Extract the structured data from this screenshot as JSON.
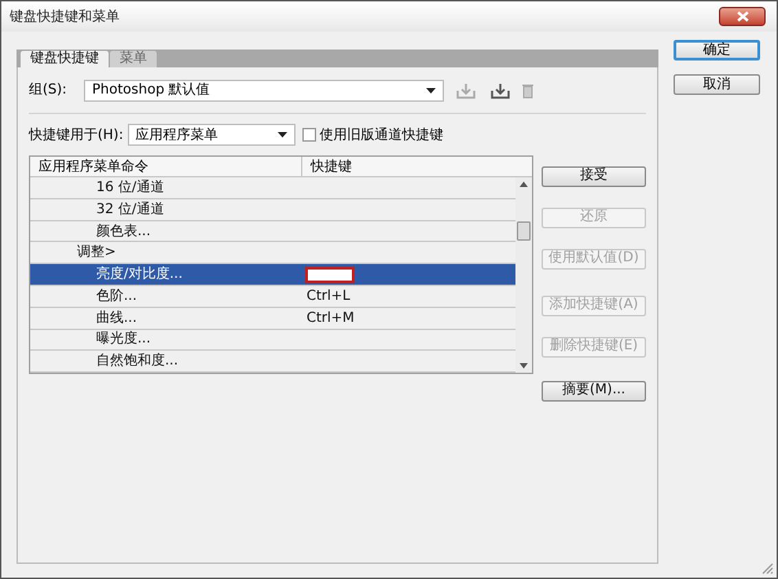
{
  "window": {
    "title": "键盘快捷键和菜单"
  },
  "tabs": [
    {
      "label": "键盘快捷键",
      "selected": true
    },
    {
      "label": "菜单",
      "selected": false
    }
  ],
  "group": {
    "label": "组(S):",
    "value": "Photoshop 默认值"
  },
  "shortcuts_for": {
    "label": "快捷键用于(H):",
    "value": "应用程序菜单"
  },
  "legacy_checkbox": {
    "label": "使用旧版通道快捷键",
    "checked": false
  },
  "table": {
    "columns": [
      "应用程序菜单命令",
      "快捷键"
    ],
    "rows": [
      {
        "kind": "item",
        "label": "16 位/通道",
        "selected": false
      },
      {
        "kind": "item",
        "label": "32 位/通道",
        "selected": false
      },
      {
        "kind": "item",
        "label": "颜色表...",
        "selected": false
      },
      {
        "kind": "group",
        "label": "调整>",
        "selected": false,
        "children": [
          {
            "kind": "item",
            "label": "亮度/对比度...",
            "selected": true,
            "editing": true
          },
          {
            "kind": "item",
            "label": "色阶...",
            "shortcut": "Ctrl+L",
            "selected": false
          },
          {
            "kind": "item",
            "label": "曲线...",
            "shortcut": "Ctrl+M",
            "selected": false
          },
          {
            "kind": "item",
            "label": "曝光度...",
            "selected": false
          },
          {
            "kind": "item",
            "label": "自然饱和度...",
            "selected": false
          }
        ]
      }
    ]
  },
  "side_buttons": [
    {
      "label": "接受",
      "disabled": false
    },
    {
      "label": "还原",
      "disabled": true
    },
    {
      "label": "使用默认值(D)",
      "disabled": true
    },
    {
      "label": "添加快捷键(A)",
      "disabled": true
    },
    {
      "label": "删除快捷键(E)",
      "disabled": true
    },
    {
      "label": "摘要(M)...",
      "disabled": false
    }
  ],
  "dialog_buttons": [
    {
      "label": "确定",
      "default": true
    },
    {
      "label": "取消",
      "default": false
    }
  ]
}
